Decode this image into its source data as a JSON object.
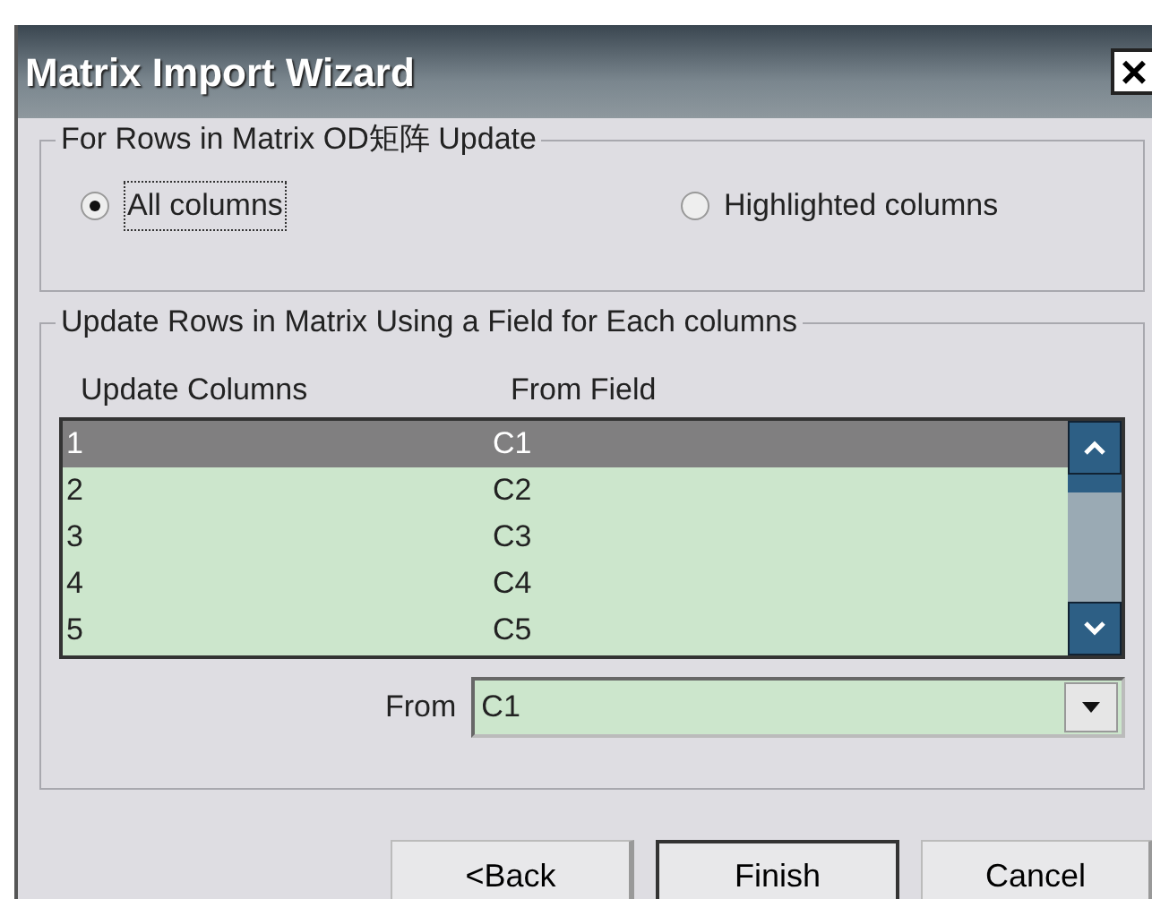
{
  "window": {
    "title": "Matrix Import Wizard",
    "close": "×"
  },
  "group_1": {
    "title": "For Rows in Matrix OD矩阵 Update",
    "options": [
      {
        "label": "All columns",
        "selected": true
      },
      {
        "label": "Highlighted columns",
        "selected": false
      }
    ]
  },
  "group_2": {
    "title": "Update Rows in Matrix Using a Field for Each columns",
    "columns": [
      "Update Columns",
      "From Field"
    ],
    "rows": [
      {
        "column": "1",
        "field": "C1",
        "selected": true
      },
      {
        "column": "2",
        "field": "C2",
        "selected": false
      },
      {
        "column": "3",
        "field": "C3",
        "selected": false
      },
      {
        "column": "4",
        "field": "C4",
        "selected": false
      },
      {
        "column": "5",
        "field": "C5",
        "selected": false
      }
    ],
    "from": {
      "label": "From",
      "value": "C1"
    }
  },
  "buttons": [
    {
      "label": "<Back",
      "default": false
    },
    {
      "label": "Finish",
      "default": true
    },
    {
      "label": "Cancel",
      "default": false
    }
  ]
}
